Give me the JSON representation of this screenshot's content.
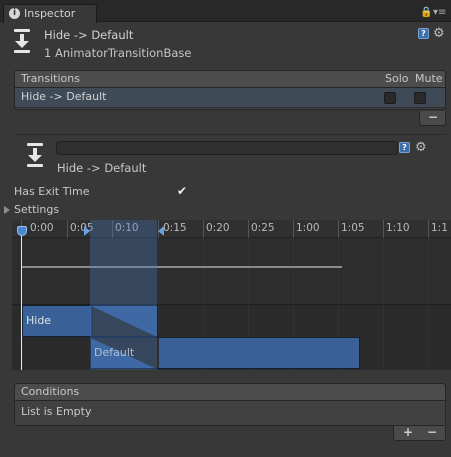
{
  "tab": {
    "title": "Inspector",
    "icon": "info-icon"
  },
  "tab_controls": {
    "lock_icon": "lock-icon",
    "menu_icon": "tab-menu-icon"
  },
  "header": {
    "title": "Hide -> Default",
    "subtitle": "1 AnimatorTransitionBase",
    "icon": "transition-icon",
    "help_icon": "help-icon",
    "settings_icon": "gear-icon"
  },
  "transitions": {
    "title": "Transitions",
    "solo_label": "Solo",
    "mute_label": "Mute",
    "rows": [
      {
        "name": "Hide -> Default",
        "solo": false,
        "mute": false
      }
    ],
    "remove_label": "−"
  },
  "transition": {
    "name_value": "",
    "subtitle": "Hide -> Default"
  },
  "properties": {
    "has_exit_time_label": "Has Exit Time",
    "has_exit_time": true,
    "settings_label": "Settings",
    "settings_expanded": false
  },
  "timeline": {
    "ticks": [
      "0:00",
      "0:05",
      "0:10",
      "0:15",
      "0:20",
      "0:25",
      "1:00",
      "1:05",
      "1:10",
      "1:1"
    ],
    "tick_label_a": "0:00",
    "tick_label_b": "0:05",
    "tick_label_c": "0:10",
    "tick_label_d": "0:15",
    "tick_label_e": "0:20",
    "tick_label_f": "0:25",
    "tick_label_g": "1:00",
    "tick_label_h": "1:05",
    "tick_label_i": "1:10",
    "tick_label_j": "1:1",
    "source_state": "Hide",
    "destination_state": "Default",
    "bar_color": "#3a6197",
    "overlap_color": "#4878be"
  },
  "conditions": {
    "title": "Conditions",
    "empty_text": "List is Empty",
    "add_label": "+",
    "remove_label": "−"
  }
}
